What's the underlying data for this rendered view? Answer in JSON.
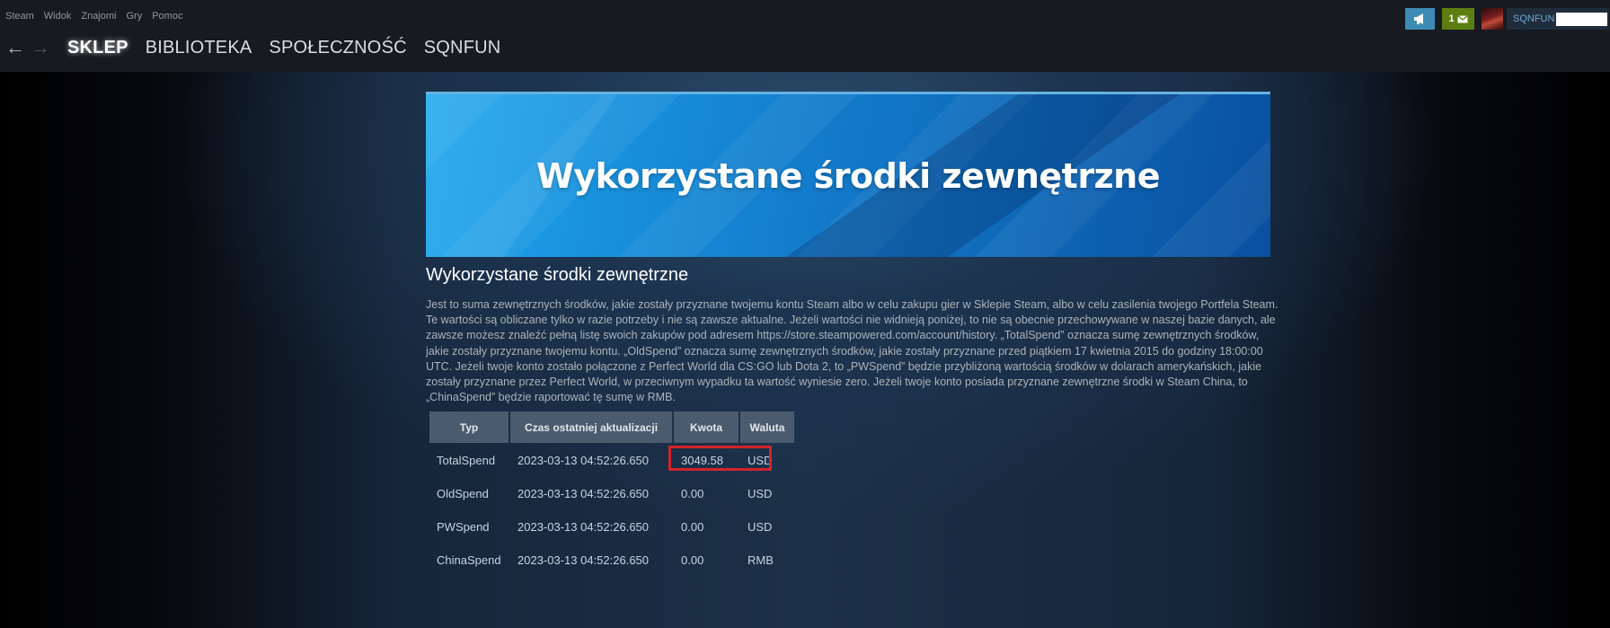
{
  "menu": [
    "Steam",
    "Widok",
    "Znajomi",
    "Gry",
    "Pomoc"
  ],
  "nav": {
    "back_icon": "arrow-left-icon",
    "forward_icon": "arrow-right-icon",
    "tabs": [
      "SKLEP",
      "BIBLIOTEKA",
      "SPOŁECZNOŚĆ",
      "SQNFUN"
    ]
  },
  "header_right": {
    "announce_icon": "megaphone-icon",
    "notifications_count": "1",
    "mail_icon": "envelope-icon",
    "username": "SQNFUN"
  },
  "banner": {
    "title": "Wykorzystane środki zewnętrzne"
  },
  "page": {
    "title": "Wykorzystane środki zewnętrzne",
    "description": "Jest to suma zewnętrznych środków, jakie zostały przyznane twojemu kontu Steam albo w celu zakupu gier w Sklepie Steam, albo w celu zasilenia twojego Portfela Steam. Te wartości są obliczane tylko w razie potrzeby i nie są zawsze aktualne. Jeżeli wartości nie widnieją poniżej, to nie są obecnie przechowywane w naszej bazie danych, ale zawsze możesz znaleźć pełną listę swoich zakupów pod adresem https://store.steampowered.com/account/history. „TotalSpend” oznacza sumę zewnętrznych środków, jakie zostały przyznane twojemu kontu. „OldSpend” oznacza sumę zewnętrznych środków, jakie zostały przyznane przed piątkiem 17 kwietnia 2015 do godziny 18:00:00 UTC. Jeżeli twoje konto zostało połączone z Perfect World dla CS:GO lub Dota 2, to „PWSpend” będzie przybliżoną wartością środków w dolarach amerykańskich, jakie zostały przyznane przez Perfect World, w przeciwnym wypadku ta wartość wyniesie zero. Jeżeli twoje konto posiada przyznane zewnętrzne środki w Steam China, to „ChinaSpend” będzie raportować tę sumę w RMB."
  },
  "table": {
    "headers": [
      "Typ",
      "Czas ostatniej aktualizacji",
      "Kwota",
      "Waluta"
    ],
    "rows": [
      [
        "TotalSpend",
        "2023-03-13 04:52:26.650",
        "3049.58",
        "USD"
      ],
      [
        "OldSpend",
        "2023-03-13 04:52:26.650",
        "0.00",
        "USD"
      ],
      [
        "PWSpend",
        "2023-03-13 04:52:26.650",
        "0.00",
        "USD"
      ],
      [
        "ChinaSpend",
        "2023-03-13 04:52:26.650",
        "0.00",
        "RMB"
      ]
    ]
  },
  "colors": {
    "highlight_box": "#d2232a",
    "accent": "#67b2e0",
    "notification_green": "#5c7e10"
  }
}
